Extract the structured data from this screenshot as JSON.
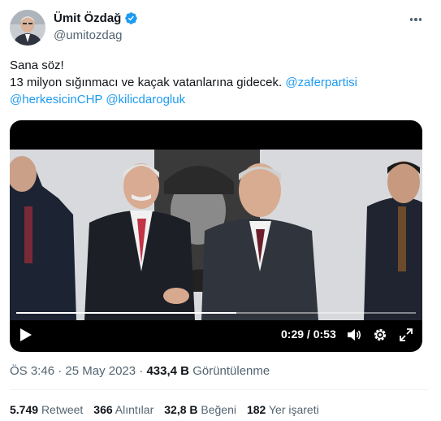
{
  "author": {
    "display_name": "Ümit Özdağ",
    "handle": "@umitozdag"
  },
  "tweet": {
    "line1": "Sana söz!",
    "line2_text": "13 milyon sığınmacı ve kaçak vatanlarına gidecek.",
    "mention1": "@zaferpartisi",
    "mention2": "@herkesicinCHP",
    "mention3": "@kilicdarogluk"
  },
  "video": {
    "elapsed": "0:29",
    "separator": "/",
    "duration": "0:53",
    "progress": 0.55
  },
  "meta": {
    "time": "ÖS 3:46",
    "dot": "·",
    "date": "25 May 2023",
    "views_count": "433,4 B",
    "views_label": "Görüntülenme"
  },
  "stats": {
    "retweets_count": "5.749",
    "retweets_label": "Retweet",
    "quotes_count": "366",
    "quotes_label": "Alıntılar",
    "likes_count": "32,8 B",
    "likes_label": "Beğeni",
    "bookmarks_count": "182",
    "bookmarks_label": "Yer işareti"
  },
  "colors": {
    "accent": "#1d9bf0",
    "secondary_text": "#536471"
  },
  "icons": [
    "verified-badge-icon",
    "more-icon",
    "play-icon",
    "volume-icon",
    "settings-icon",
    "fullscreen-icon"
  ]
}
